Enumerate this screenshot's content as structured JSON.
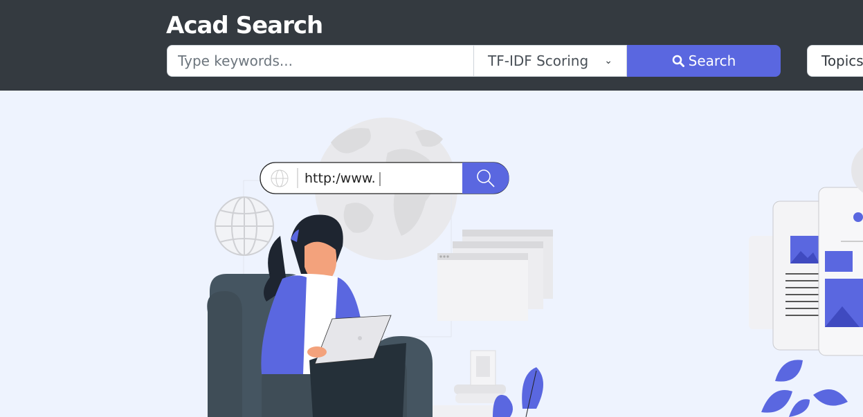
{
  "app": {
    "title": "Acad Search"
  },
  "search": {
    "placeholder": "Type keywords...",
    "value": ""
  },
  "scoring": {
    "selected": "TF-IDF Scoring"
  },
  "buttons": {
    "search_label": "Search",
    "topics_label": "Topics"
  },
  "illustration": {
    "url_text": "http:/www.",
    "icon_search": "search-icon",
    "icon_globe": "globe-icon"
  },
  "colors": {
    "header_bg": "#343a40",
    "accent": "#5a67e0",
    "page_bg": "#eef3fe",
    "dark_figure": "#455561"
  }
}
